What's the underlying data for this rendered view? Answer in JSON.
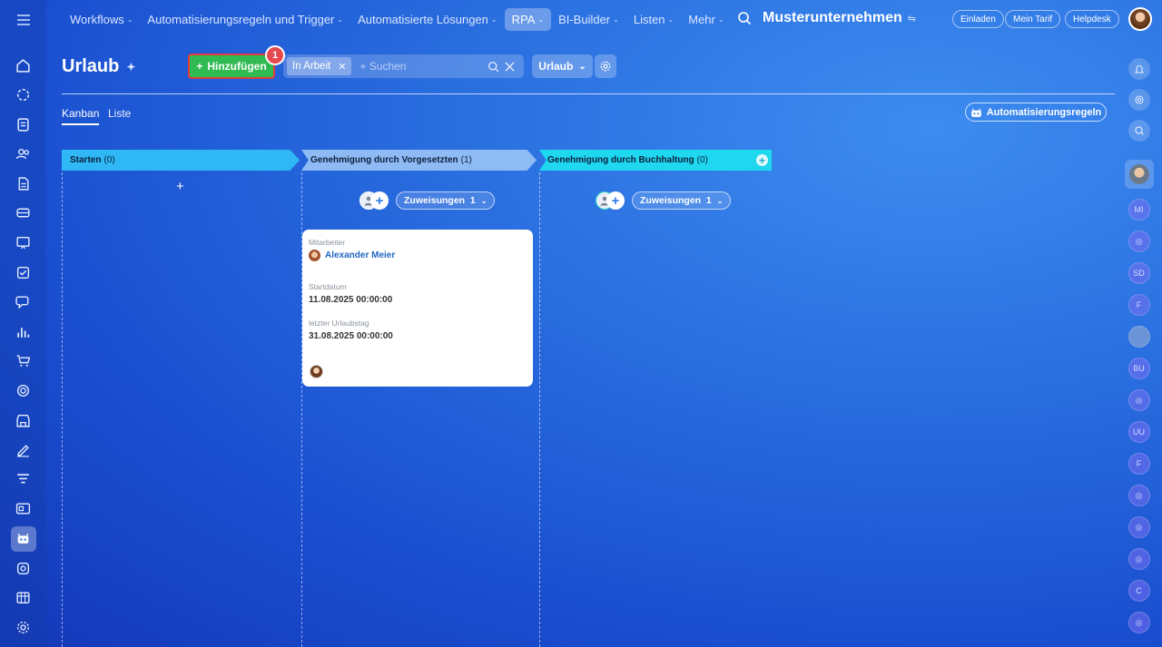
{
  "topnav": {
    "items": [
      {
        "label": "Workflows",
        "chevron": true
      },
      {
        "label": "Automatisierungsregeln und Trigger",
        "chevron": true
      },
      {
        "label": "Automatisierte Lösungen",
        "chevron": true
      },
      {
        "label": "RPA",
        "chevron": true,
        "active": true
      },
      {
        "label": "BI-Builder",
        "chevron": true
      },
      {
        "label": "Listen",
        "chevron": true
      },
      {
        "label": "Mehr",
        "chevron": true
      }
    ],
    "company": "Musterunternehmen",
    "invite": "Einladen",
    "plan": "Mein Tarif",
    "helpdesk": "Helpdesk"
  },
  "header": {
    "title": "Urlaub",
    "add_button": "Hinzufügen",
    "badge": "1",
    "filter_chip": "In Arbeit",
    "search_placeholder": "+ Suchen",
    "view_select": "Urlaub"
  },
  "tabs": {
    "kanban": "Kanban",
    "liste": "Liste"
  },
  "automation_button": "Automatisierungsregeln",
  "columns": [
    {
      "title": "Starten",
      "count": "(0)",
      "color": "#2fb8f5"
    },
    {
      "title": "Genehmigung durch Vorgesetzten",
      "count": "(1)",
      "color": "#8fbbf5",
      "assignments": "Zuweisungen  1"
    },
    {
      "title": "Genehmigung durch Buchhaltung",
      "count": "(0)",
      "color": "#1fd7ef",
      "assignments": "Zuweisungen  1"
    }
  ],
  "card": {
    "employee_label": "Mitarbeiter",
    "employee_name": "Alexander Meier",
    "start_label": "Startdatum",
    "start_value": "11.08.2025 00:00:00",
    "end_label": "letzter Urlaubstag",
    "end_value": "31.08.2025 00:00:00"
  },
  "right_bar": {
    "users": [
      "MI",
      "SD",
      "F",
      "BU",
      "UU",
      "F",
      "C"
    ]
  },
  "colors": {
    "accent_green": "#2fba52",
    "highlight_red": "#e53a3a",
    "link_blue": "#1f66c2"
  }
}
